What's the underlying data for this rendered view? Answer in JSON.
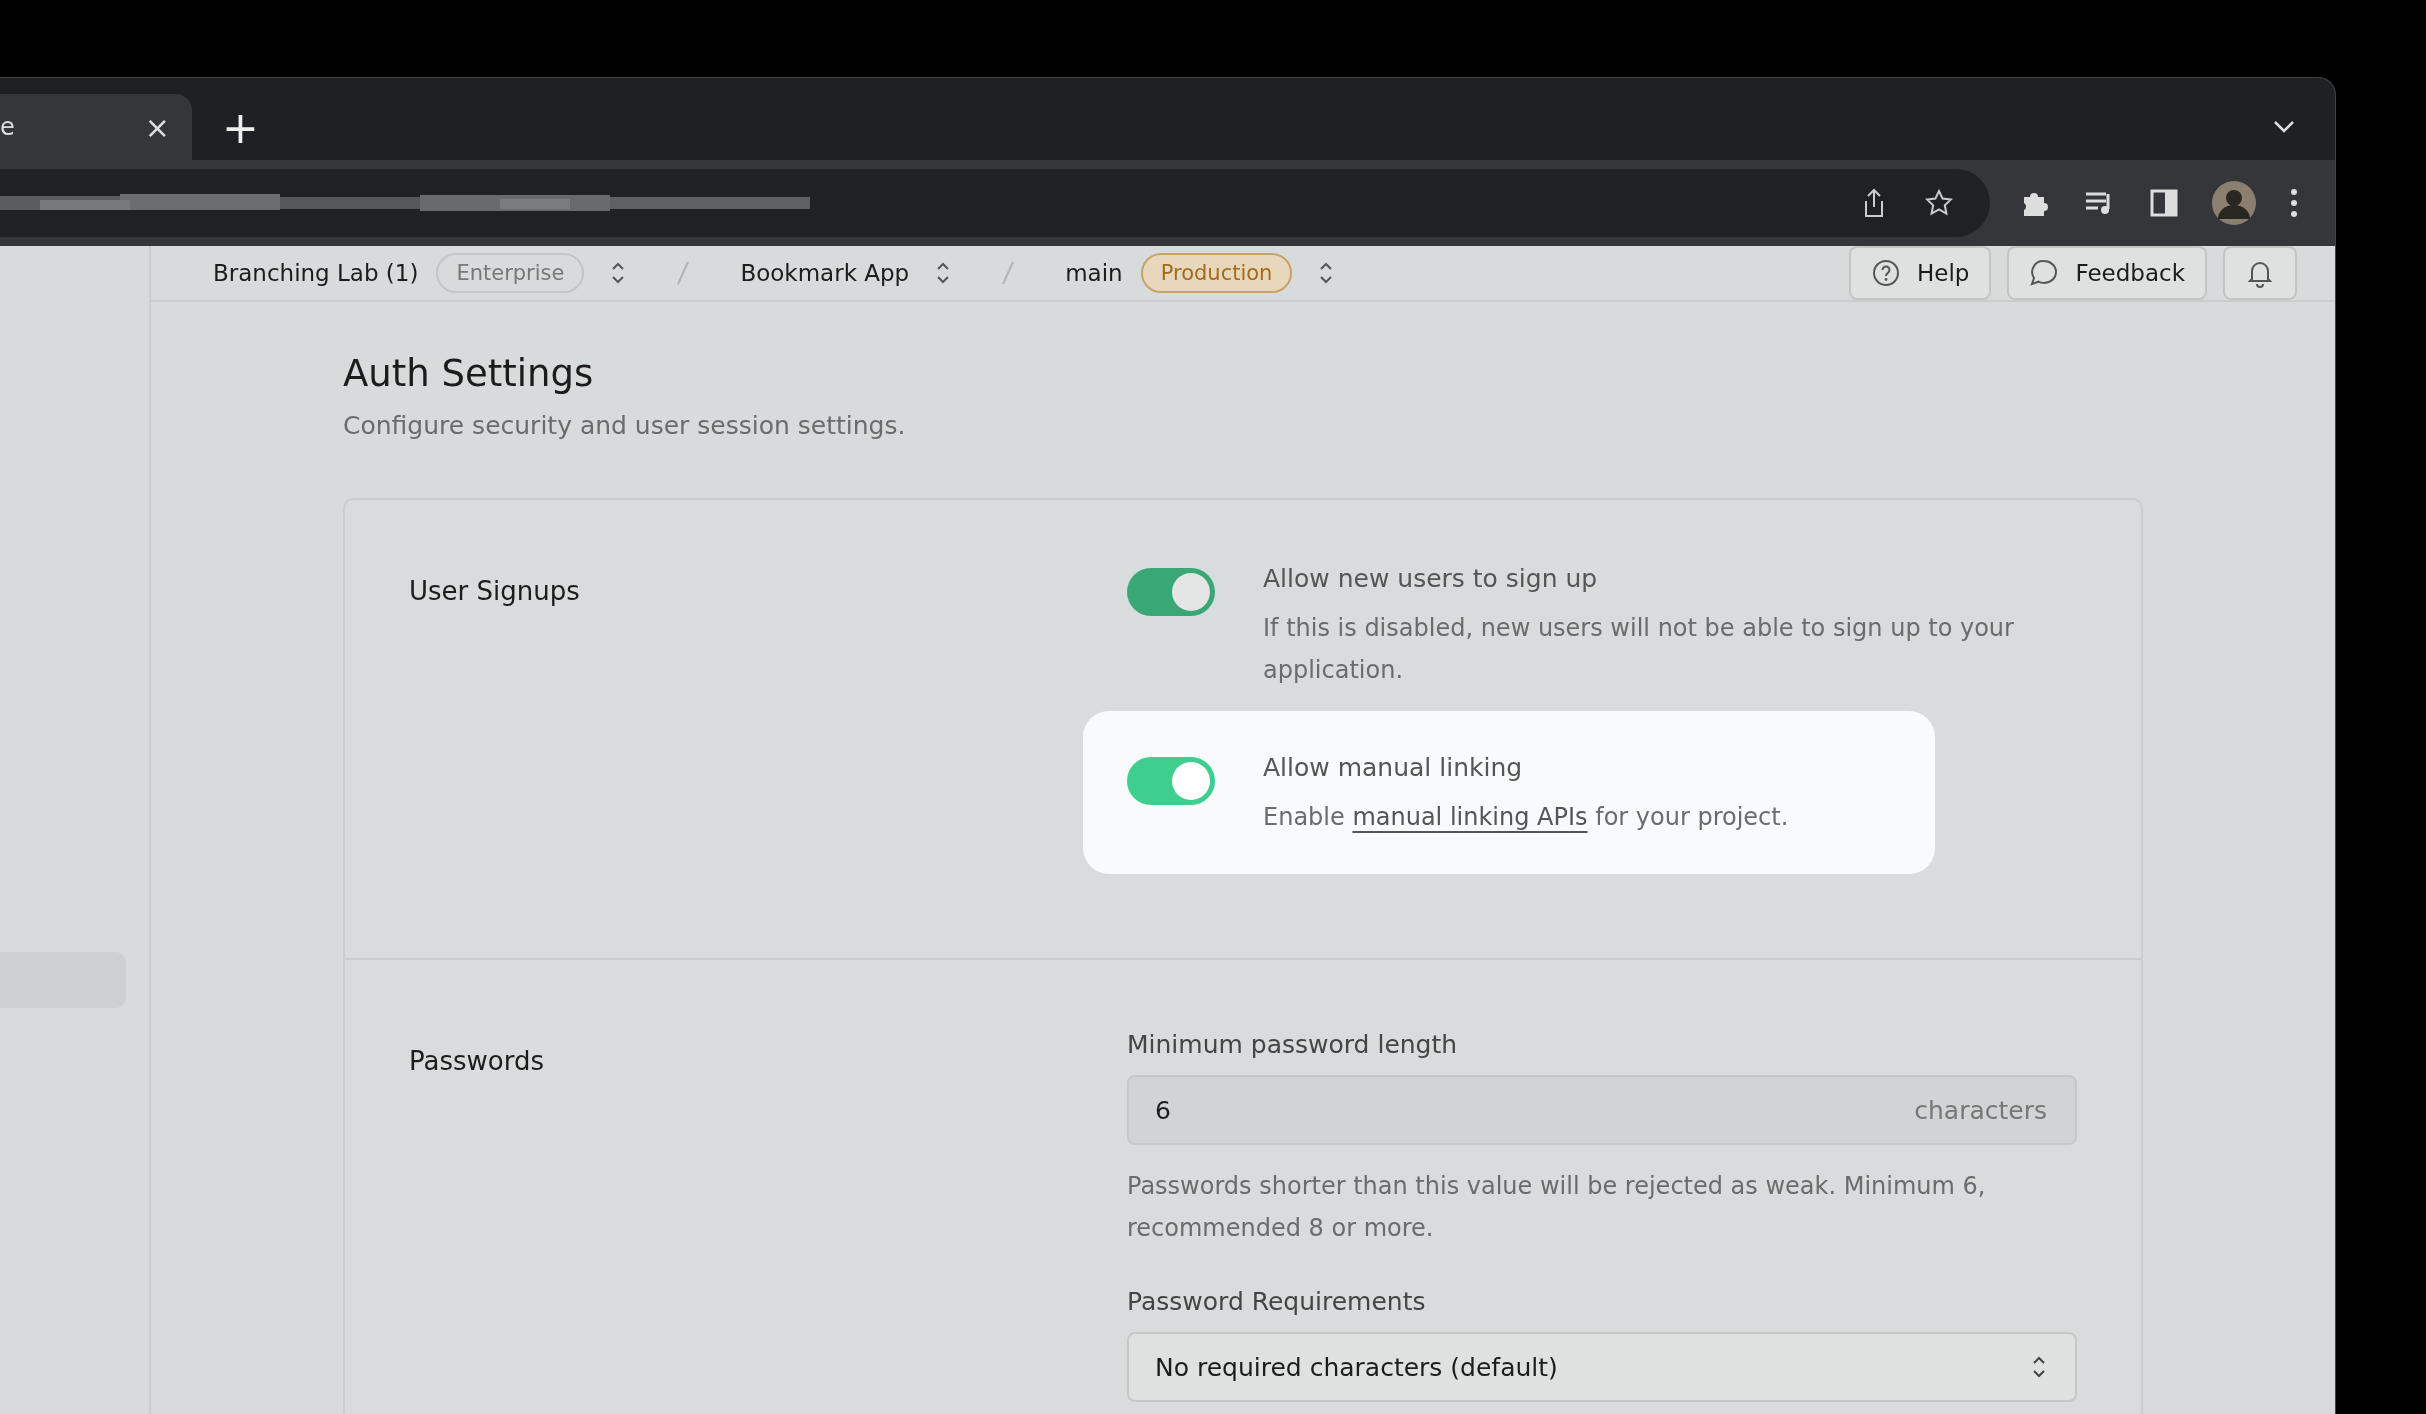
{
  "browser": {
    "tab": {
      "title": "e",
      "close": "×"
    },
    "new_tab": "+"
  },
  "breadcrumb": [
    {
      "label": "Branching Lab (1)",
      "badge": {
        "text": "Enterprise",
        "kind": "plain"
      }
    },
    {
      "label": "Bookmark App"
    },
    {
      "label": "main",
      "badge": {
        "text": "Production",
        "kind": "warning"
      }
    }
  ],
  "header_buttons": [
    {
      "kind": "help",
      "label": "Help"
    },
    {
      "kind": "feedback",
      "label": "Feedback"
    },
    {
      "kind": "notifications"
    }
  ],
  "page": {
    "title": "Auth Settings",
    "description": "Configure security and user session settings."
  },
  "sections": [
    {
      "title": "User Signups",
      "settings": [
        {
          "kind": "toggle",
          "label": "Allow new users to sign up",
          "on": true,
          "highlighted": false,
          "description": {
            "before": "If this is disabled, new users will not be able to sign up to your application."
          }
        },
        {
          "kind": "toggle",
          "label": "Allow manual linking",
          "on": true,
          "highlighted": true,
          "description": {
            "before": "Enable ",
            "link": "manual linking APIs",
            "after": " for your project."
          }
        }
      ]
    },
    {
      "title": "Passwords",
      "settings": [
        {
          "kind": "number",
          "label": "Minimum password length",
          "value": "6",
          "suffix": "characters",
          "description": {
            "before": "Passwords shorter than this value will be rejected as weak. Minimum 6, recommended 8 or more."
          }
        },
        {
          "kind": "select",
          "label": "Password Requirements",
          "value": "No required characters (default)"
        }
      ]
    }
  ]
}
